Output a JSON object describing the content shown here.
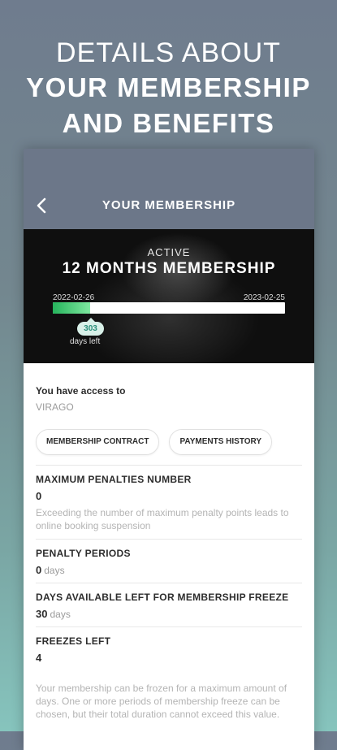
{
  "promo": {
    "line1": "DETAILS ABOUT",
    "line2": "YOUR MEMBERSHIP",
    "line3": "AND BENEFITS"
  },
  "header": {
    "title": "YOUR MEMBERSHIP",
    "back_icon": "chevron-left-icon"
  },
  "membership": {
    "status": "ACTIVE",
    "plan": "12 MONTHS MEMBERSHIP",
    "start_date": "2022-02-26",
    "end_date": "2023-02-25",
    "progress_fraction": 0.16,
    "days_left_value": "303",
    "days_left_label": "days left"
  },
  "access": {
    "title": "You have access to",
    "value": "VIRAGO"
  },
  "buttons": {
    "contract": "MEMBERSHIP CONTRACT",
    "payments": "PAYMENTS HISTORY"
  },
  "sections": {
    "max_penalties": {
      "label": "MAXIMUM PENALTIES NUMBER",
      "value": "0",
      "note": "Exceeding the number of maximum penalty points leads to online booking suspension"
    },
    "penalty_periods": {
      "label": "PENALTY PERIODS",
      "value": "0",
      "unit": "days"
    },
    "freeze_days": {
      "label": "DAYS AVAILABLE LEFT FOR MEMBERSHIP FREEZE",
      "value": "30",
      "unit": "days"
    },
    "freezes_left": {
      "label": "FREEZES LEFT",
      "value": "4"
    }
  },
  "freeze_note": "Your membership can be frozen for a maximum amount of days. One or more periods of membership freeze can be chosen, but their total duration cannot exceed this value.",
  "colors": {
    "appbar": "#6c7789",
    "progress": "#26b35c",
    "badge_bg": "#d8f0e8"
  }
}
